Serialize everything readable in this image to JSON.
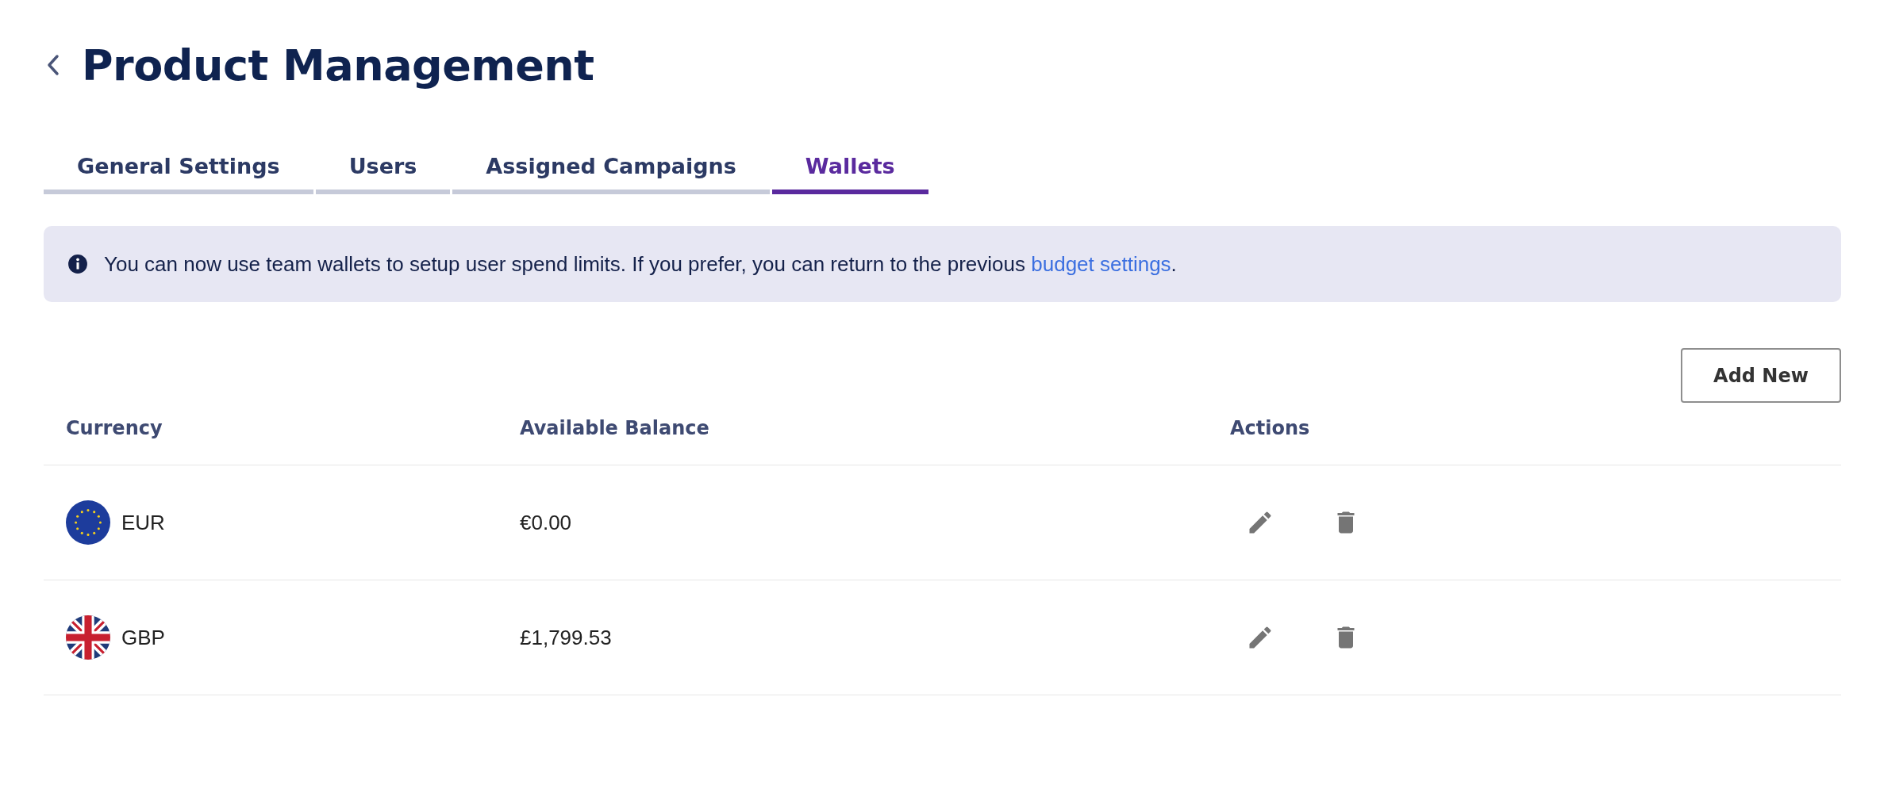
{
  "page": {
    "title": "Product Management"
  },
  "tabs": [
    {
      "label": "General Settings",
      "selected": false
    },
    {
      "label": "Users",
      "selected": false
    },
    {
      "label": "Assigned Campaigns",
      "selected": false
    },
    {
      "label": "Wallets",
      "selected": true
    }
  ],
  "info_banner": {
    "text": "You can now use team wallets to setup user spend limits. If you prefer, you can return to the previous ",
    "link": "budget settings",
    "text_end": "."
  },
  "add_button": "Add New",
  "table": {
    "columns": [
      "Currency",
      "Available Balance",
      "Actions"
    ],
    "rows": [
      {
        "flag": {
          "kind": "eu"
        },
        "currency": "EUR",
        "balance": "€0.00"
      },
      {
        "flag": {
          "kind": "uk"
        },
        "currency": "GBP",
        "balance": "£1,799.53"
      }
    ]
  }
}
